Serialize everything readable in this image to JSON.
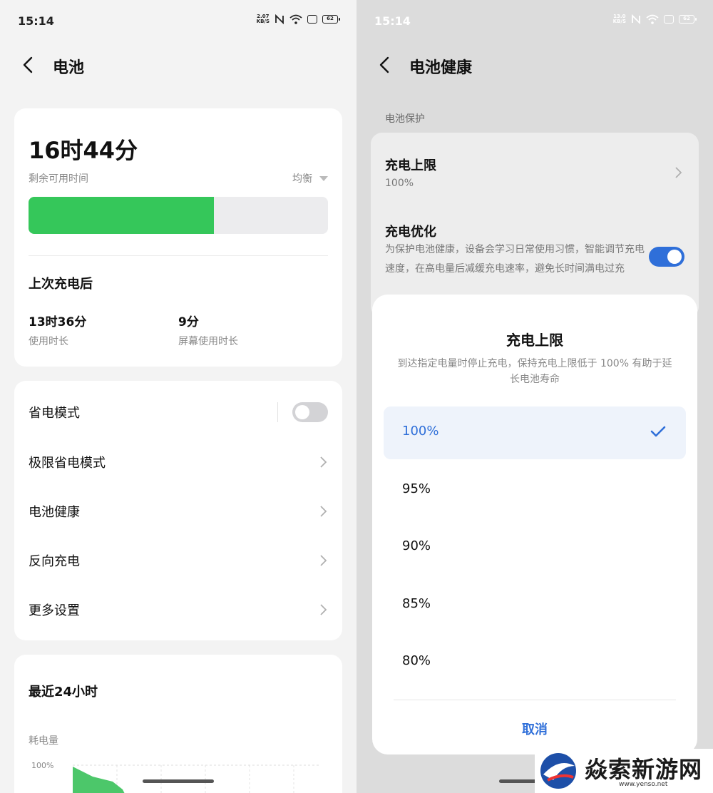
{
  "left": {
    "status": {
      "time": "15:14",
      "net_speed_value": "2.07",
      "net_speed_unit": "KB/S",
      "battery": "62"
    },
    "header": {
      "title": "电池"
    },
    "summary": {
      "remaining_time": "16时44分",
      "remaining_label": "剩余可用时间",
      "mode": "均衡",
      "battery_level_fraction": 0.62,
      "since_charge_title": "上次充电后",
      "usage_value": "13时36分",
      "usage_label": "使用时长",
      "screen_value": "9分",
      "screen_label": "屏幕使用时长"
    },
    "settings": [
      {
        "label": "省电模式",
        "type": "toggle",
        "on": false
      },
      {
        "label": "极限省电模式",
        "type": "link"
      },
      {
        "label": "电池健康",
        "type": "link"
      },
      {
        "label": "反向充电",
        "type": "link"
      },
      {
        "label": "更多设置",
        "type": "link"
      }
    ],
    "recent": {
      "title": "最近24小时",
      "consumption_label": "耗电量",
      "axis_top": "100%"
    }
  },
  "right": {
    "status": {
      "time": "15:14",
      "net_speed_value": "13.0",
      "net_speed_unit": "KB/S",
      "battery": "62"
    },
    "header": {
      "title": "电池健康"
    },
    "section_title": "电池保护",
    "charge_limit": {
      "title": "充电上限",
      "value": "100%"
    },
    "charge_opt": {
      "title": "充电优化",
      "desc": "为保护电池健康，设备会学习日常使用习惯，智能调节充电速度，在高电量后减缓充电速率，避免长时间满电过充",
      "on": true
    },
    "sheet": {
      "title": "充电上限",
      "desc": "到达指定电量时停止充电，保持充电上限低于 100% 有助于延长电池寿命",
      "options": [
        "100%",
        "95%",
        "90%",
        "85%",
        "80%"
      ],
      "selected": "100%",
      "cancel": "取消"
    }
  },
  "watermark": {
    "text": "焱索新游网",
    "url": "www.yenso.net"
  },
  "colors": {
    "accent": "#2f6fd9",
    "battery_green": "#35c75a"
  }
}
